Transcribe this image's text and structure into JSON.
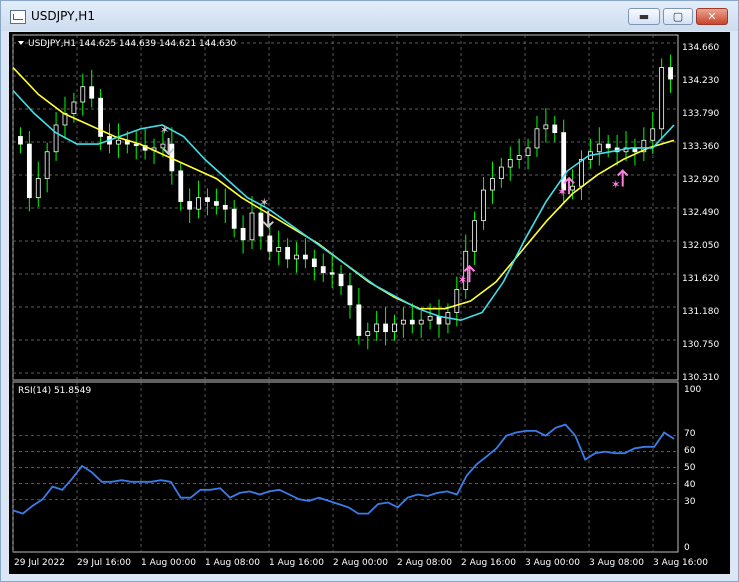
{
  "window": {
    "title": "USDJPY,H1",
    "buttons": {
      "minimize": "▬",
      "maximize": "▢",
      "close": "✕"
    }
  },
  "main_chart": {
    "symbol_info": "USDJPY,H1  144.625 144.639 144.621 144.630",
    "price_labels": [
      "134.660",
      "134.230",
      "133.790",
      "133.360",
      "132.920",
      "132.490",
      "132.050",
      "131.620",
      "131.180",
      "130.750",
      "130.310"
    ],
    "colors": {
      "bull_candle": "#ffffff",
      "bear_candle": "#ffffff",
      "wick": "#00ff00",
      "ma_fast": "#40e0e8",
      "ma_slow": "#ffff33",
      "grid": "#7a7a7a",
      "sell_arrow": "#c8c8c8",
      "buy_arrow": "#ff7fe0"
    }
  },
  "rsi_panel": {
    "label": "RSI(14) 51.8549",
    "levels": [
      "100",
      "70",
      "60",
      "50",
      "40",
      "30",
      "0"
    ],
    "line_color": "#3a7de8"
  },
  "time_axis": [
    "29 Jul 2022",
    "29 Jul 16:00",
    "1 Aug 00:00",
    "1 Aug 08:00",
    "1 Aug 16:00",
    "2 Aug 00:00",
    "2 Aug 08:00",
    "2 Aug 16:00",
    "3 Aug 00:00",
    "3 Aug 08:00",
    "3 Aug 16:00"
  ],
  "chart_data": {
    "type": "candlestick",
    "timeframe": "H1",
    "ylim": [
      130.31,
      134.66
    ],
    "close": [
      133.3,
      132.6,
      132.85,
      133.2,
      133.55,
      133.7,
      133.85,
      134.05,
      133.9,
      133.4,
      133.3,
      133.35,
      133.3,
      133.28,
      133.22,
      133.25,
      133.3,
      132.95,
      132.55,
      132.45,
      132.6,
      132.55,
      132.5,
      132.45,
      132.2,
      132.05,
      132.4,
      132.1,
      131.9,
      131.95,
      131.8,
      131.85,
      131.8,
      131.7,
      131.62,
      131.6,
      131.45,
      131.2,
      130.8,
      130.85,
      130.95,
      130.85,
      130.95,
      131.0,
      130.95,
      131.0,
      131.05,
      130.95,
      131.1,
      131.4,
      131.9,
      132.3,
      132.7,
      132.85,
      133.0,
      133.1,
      133.15,
      133.25,
      133.5,
      133.55,
      133.45,
      132.7,
      132.75,
      133.1,
      133.2,
      133.3,
      133.25,
      133.2,
      133.25,
      133.2,
      133.35,
      133.5,
      134.3,
      134.15
    ],
    "rsi": [
      23,
      21,
      26,
      30,
      38,
      36,
      43,
      51,
      47,
      41,
      41,
      42,
      41,
      41,
      41,
      42,
      41,
      31,
      31,
      36,
      36,
      37,
      31,
      34,
      35,
      33,
      35,
      36,
      33,
      30,
      29,
      31,
      29,
      27,
      25,
      21,
      21,
      27,
      28,
      25,
      31,
      33,
      32,
      34,
      35,
      33,
      45,
      52,
      57,
      62,
      70,
      72,
      73,
      73,
      70,
      75,
      77,
      70,
      55,
      59,
      60,
      59,
      59,
      62,
      63,
      63,
      72,
      68
    ],
    "ma_fast": [
      134.0,
      133.7,
      133.45,
      133.3,
      133.3,
      133.4,
      133.5,
      133.55,
      133.4,
      133.1,
      132.85,
      132.6,
      132.45,
      132.25,
      132.05,
      131.85,
      131.65,
      131.45,
      131.3,
      131.15,
      131.05,
      131.0,
      131.1,
      131.5,
      132.05,
      132.55,
      132.95,
      133.15,
      133.2,
      133.25,
      133.25,
      133.55
    ],
    "ma_slow": [
      134.3,
      133.95,
      133.7,
      133.55,
      133.4,
      133.3,
      133.15,
      133.0,
      132.85,
      132.6,
      132.4,
      132.2,
      132.0,
      131.75,
      131.5,
      131.3,
      131.15,
      131.15,
      131.25,
      131.5,
      131.9,
      132.3,
      132.65,
      132.9,
      133.1,
      133.25,
      133.35
    ],
    "markers": [
      {
        "type": "sell",
        "price": 133.25
      },
      {
        "type": "sell",
        "price": 132.3
      },
      {
        "type": "buy",
        "price": 131.6
      },
      {
        "type": "buy",
        "price": 132.75
      },
      {
        "type": "buy",
        "price": 132.85
      }
    ]
  }
}
